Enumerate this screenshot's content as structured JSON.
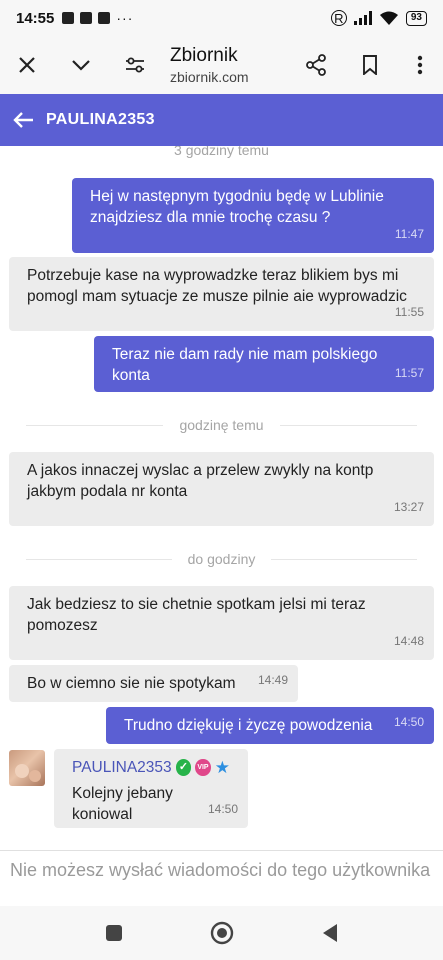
{
  "status_bar": {
    "time": "14:55",
    "battery": "93"
  },
  "browser": {
    "title": "Zbiornik",
    "domain": "zbiornik.com"
  },
  "chat": {
    "contact": "PAULINA2353"
  },
  "messages": [
    {
      "dir": "sep",
      "text": "3 godziny temu"
    },
    {
      "dir": "out",
      "text": "Hej w następnym tygodniu będę w Lublinie znajdziesz dla mnie trochę czasu ?",
      "time": "11:47"
    },
    {
      "dir": "in",
      "text": "Potrzebuje kase na wyprowadzke teraz blikiem bys mi pomogl mam sytuacje ze musze pilnie aie wyprowadzic",
      "time": "11:55"
    },
    {
      "dir": "out",
      "text": "Teraz nie dam rady nie mam polskiego konta",
      "time": "11:57"
    },
    {
      "dir": "sep",
      "text": "godzinę temu"
    },
    {
      "dir": "in",
      "text": "A jakos innaczej wyslac a przelew zwykly na kontp jakbym podala nr konta",
      "time": "13:27"
    },
    {
      "dir": "sep",
      "text": "do godziny"
    },
    {
      "dir": "in",
      "text": "Jak bedziesz to sie chetnie spotkam jelsi mi teraz pomozesz",
      "time": "14:48"
    },
    {
      "dir": "in",
      "text": "Bo w ciemno sie nie spotykam",
      "time": "14:49"
    },
    {
      "dir": "out",
      "text": "Trudno dziękuję i życzę powodzenia",
      "time": "14:50"
    },
    {
      "dir": "in-card",
      "author": "PAULINA2353",
      "vip": "VIP",
      "text": "Kolejny jebany koniowal",
      "time": "14:50"
    }
  ],
  "input_note": "Nie możesz wysłać wiadomości do tego użytkownika",
  "colors": {
    "accent": "#5b5fd3",
    "incoming_bubble": "#ececec",
    "nick": "#4a55b8"
  }
}
